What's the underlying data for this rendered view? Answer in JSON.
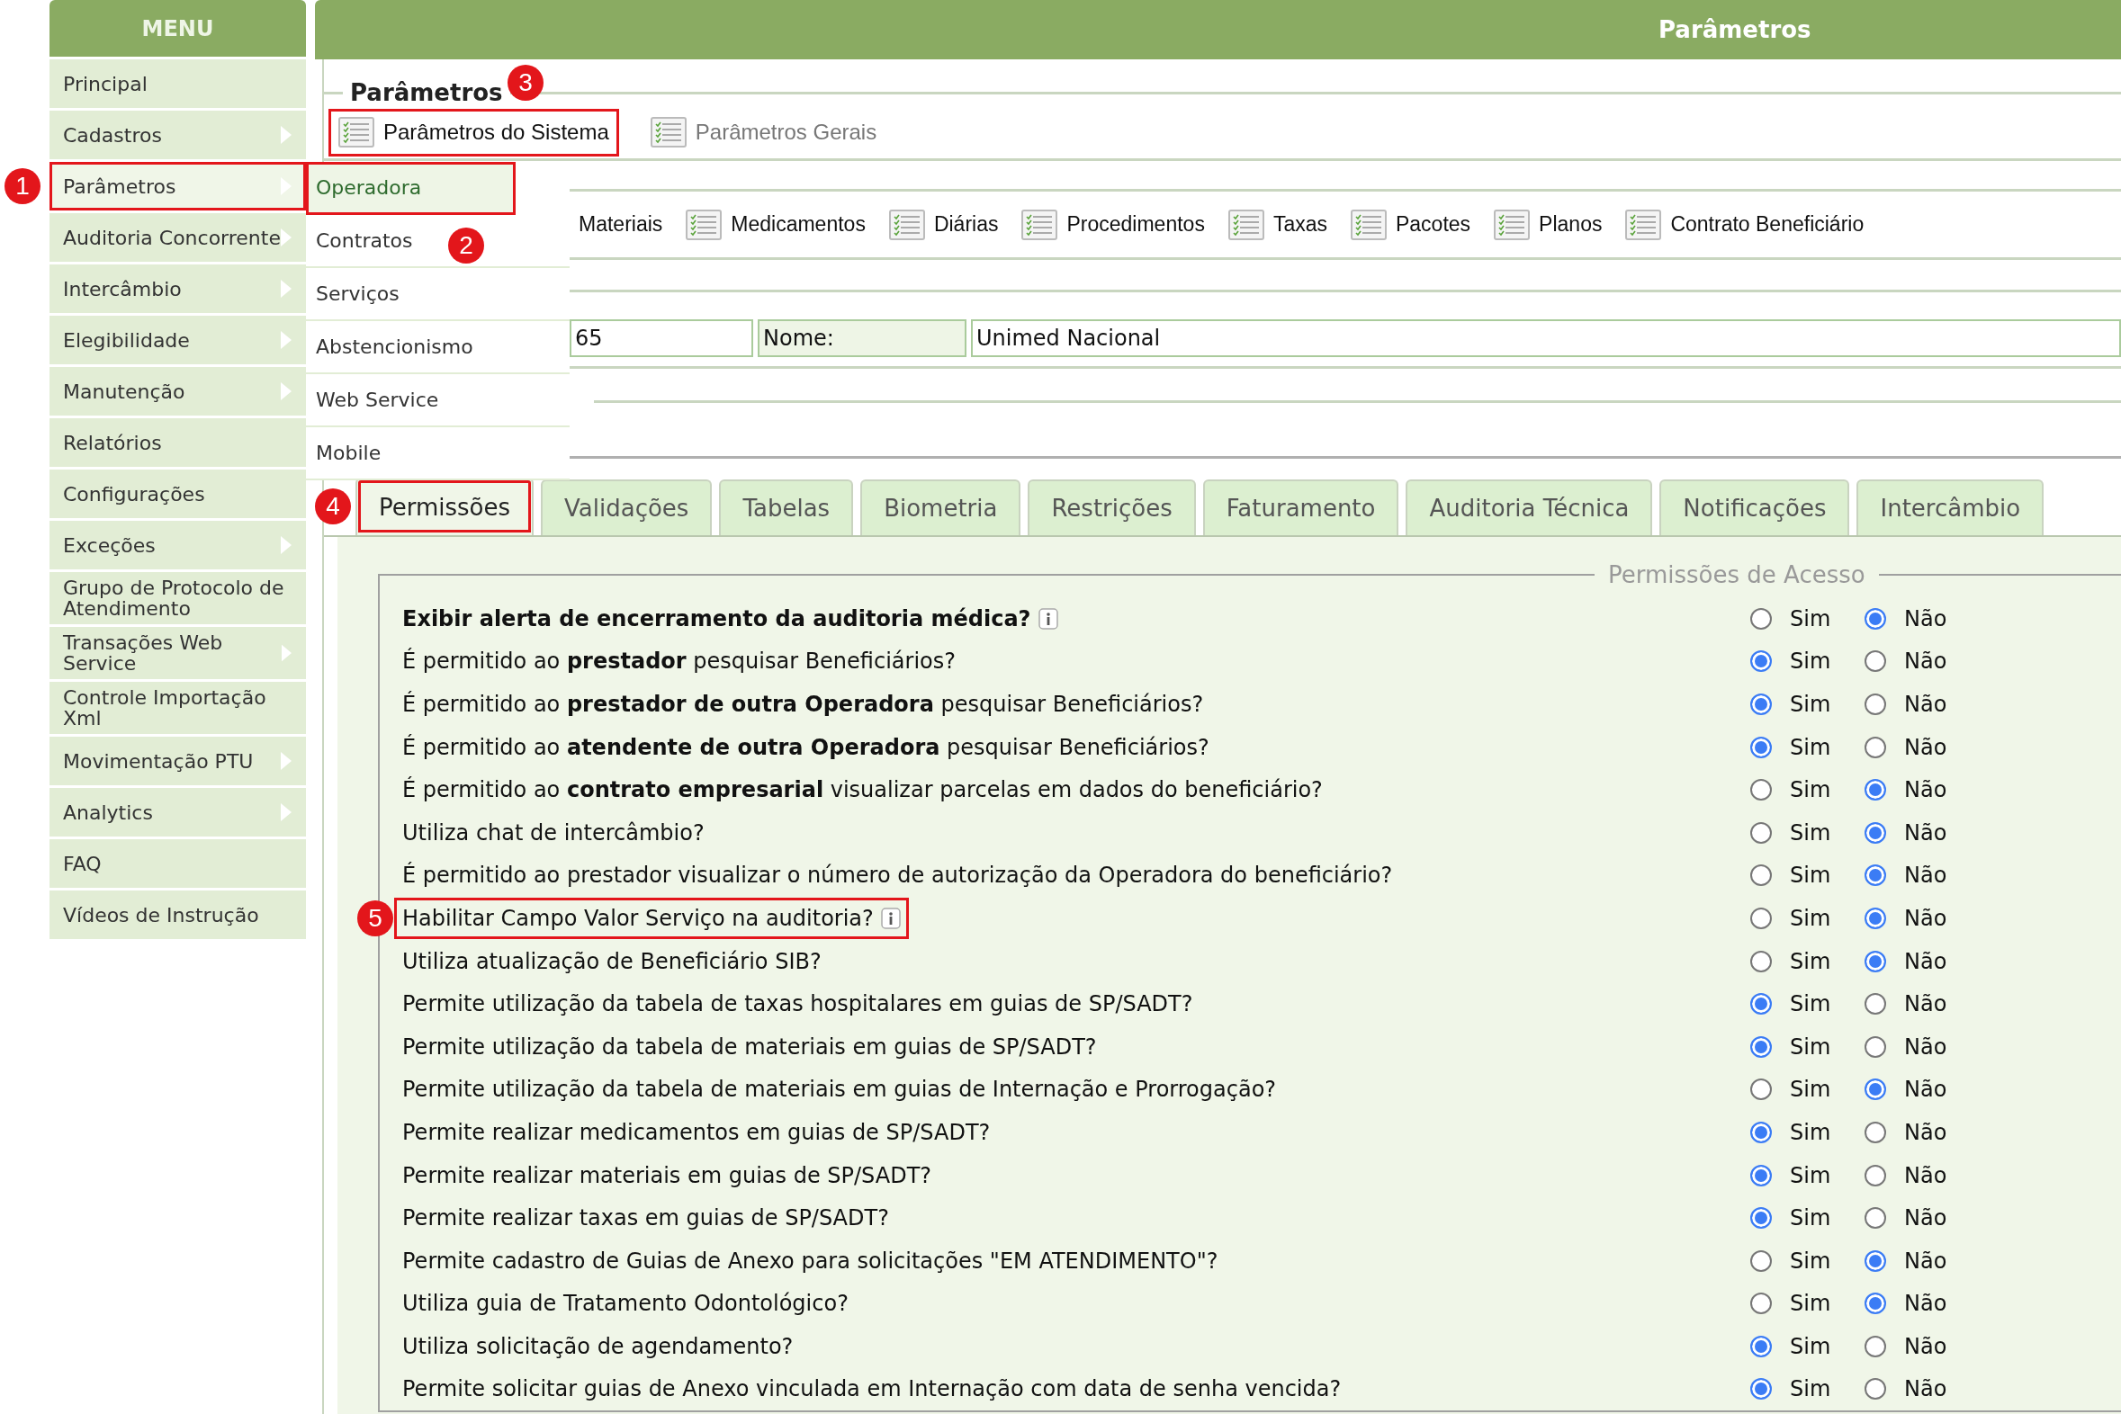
{
  "menu": {
    "title": "MENU",
    "items": [
      {
        "label": "Principal",
        "has_submenu": false,
        "selected": false
      },
      {
        "label": "Cadastros",
        "has_submenu": true,
        "selected": false
      },
      {
        "label": "Parâmetros",
        "has_submenu": true,
        "selected": true,
        "callout": {
          "number": "1",
          "boxed": true
        }
      },
      {
        "label": "Auditoria Concorrente",
        "has_submenu": true,
        "selected": false
      },
      {
        "label": "Intercâmbio",
        "has_submenu": true,
        "selected": false
      },
      {
        "label": "Elegibilidade",
        "has_submenu": true,
        "selected": false
      },
      {
        "label": "Manutenção",
        "has_submenu": true,
        "selected": false
      },
      {
        "label": "Relatórios",
        "has_submenu": false,
        "selected": false
      },
      {
        "label": "Configurações",
        "has_submenu": false,
        "selected": false
      },
      {
        "label": "Exceções",
        "has_submenu": true,
        "selected": false
      },
      {
        "label": "Grupo de Protocolo de Atendimento",
        "has_submenu": false,
        "selected": false
      },
      {
        "label": "Transações Web Service",
        "has_submenu": true,
        "selected": false
      },
      {
        "label": "Controle Importação Xml",
        "has_submenu": false,
        "selected": false
      },
      {
        "label": "Movimentação PTU",
        "has_submenu": true,
        "selected": false
      },
      {
        "label": "Analytics",
        "has_submenu": true,
        "selected": false
      },
      {
        "label": "FAQ",
        "has_submenu": false,
        "selected": false
      },
      {
        "label": "Vídeos de Instrução",
        "has_submenu": false,
        "selected": false
      }
    ]
  },
  "submenu": {
    "items": [
      {
        "label": "Operadora",
        "selected": true,
        "callout": {
          "boxed": true
        }
      },
      {
        "label": "Contratos",
        "selected": false,
        "callout": {
          "number": "2",
          "boxed": false
        }
      },
      {
        "label": "Serviços",
        "selected": false
      },
      {
        "label": "Abstencionismo",
        "selected": false
      },
      {
        "label": "Web Service",
        "selected": false
      },
      {
        "label": "Mobile",
        "selected": false
      }
    ]
  },
  "header": {
    "title": "Parâmetros"
  },
  "section": {
    "title": "Parâmetros",
    "tabs": [
      {
        "label": "Parâmetros do Sistema",
        "selected": true,
        "callout": {
          "number": "3",
          "boxed": true
        }
      },
      {
        "label": "Parâmetros Gerais",
        "selected": false
      }
    ]
  },
  "shortcuts": [
    {
      "label": "Materiais",
      "icon": false
    },
    {
      "label": "Medicamentos",
      "icon": true
    },
    {
      "label": "Diárias",
      "icon": true
    },
    {
      "label": "Procedimentos",
      "icon": true
    },
    {
      "label": "Taxas",
      "icon": true
    },
    {
      "label": "Pacotes",
      "icon": true
    },
    {
      "label": "Planos",
      "icon": true
    },
    {
      "label": "Contrato Beneficiário",
      "icon": true
    }
  ],
  "operator": {
    "code": "65",
    "name_label": "Nome:",
    "name": "Unimed Nacional"
  },
  "tabs": [
    {
      "label": "Permissões",
      "selected": true,
      "callout": {
        "number": "4",
        "boxed": true
      }
    },
    {
      "label": "Validações",
      "selected": false
    },
    {
      "label": "Tabelas",
      "selected": false
    },
    {
      "label": "Biometria",
      "selected": false
    },
    {
      "label": "Restrições",
      "selected": false
    },
    {
      "label": "Faturamento",
      "selected": false
    },
    {
      "label": "Auditoria Técnica",
      "selected": false
    },
    {
      "label": "Notificações",
      "selected": false
    },
    {
      "label": "Intercâmbio",
      "selected": false
    }
  ],
  "permissions": {
    "legend": "Permissões de Acesso",
    "rows": [
      {
        "question": "Exibir alerta de encerramento da auditoria médica?",
        "bold": true,
        "info": true,
        "options": [
          {
            "label": "Sim",
            "selected": false
          },
          {
            "label": "Não",
            "selected": true
          }
        ]
      },
      {
        "question": "É permitido ao **prestador** pesquisar Beneficiários?",
        "options": [
          {
            "label": "Sim",
            "selected": true
          },
          {
            "label": "Não",
            "selected": false
          }
        ]
      },
      {
        "question": "É permitido ao **prestador de outra Operadora** pesquisar Beneficiários?",
        "options": [
          {
            "label": "Sim",
            "selected": true
          },
          {
            "label": "Não",
            "selected": false
          }
        ]
      },
      {
        "question": "É permitido ao **atendente de outra Operadora** pesquisar Beneficiários?",
        "options": [
          {
            "label": "Sim",
            "selected": true
          },
          {
            "label": "Não",
            "selected": false
          }
        ]
      },
      {
        "question": "É permitido ao **contrato empresarial** visualizar parcelas em dados do beneficiário?",
        "options": [
          {
            "label": "Sim",
            "selected": false
          },
          {
            "label": "Não",
            "selected": true
          }
        ]
      },
      {
        "question": "Utiliza chat de intercâmbio?",
        "options": [
          {
            "label": "Sim",
            "selected": false
          },
          {
            "label": "Não",
            "selected": true
          }
        ]
      },
      {
        "question": "É permitido ao prestador visualizar o número de autorização da Operadora do beneficiário?",
        "options": [
          {
            "label": "Sim",
            "selected": false
          },
          {
            "label": "Não",
            "selected": true
          }
        ]
      },
      {
        "question": "Habilitar Campo Valor Serviço na auditoria?",
        "info": true,
        "callout": {
          "number": "5",
          "boxed": true
        },
        "options": [
          {
            "label": "Sim",
            "selected": false
          },
          {
            "label": "Não",
            "selected": true
          }
        ]
      },
      {
        "question": "Utiliza atualização de Beneficiário SIB?",
        "options": [
          {
            "label": "Sim",
            "selected": false
          },
          {
            "label": "Não",
            "selected": true
          }
        ]
      },
      {
        "question": "Permite utilização da tabela de taxas hospitalares em guias de SP/SADT?",
        "options": [
          {
            "label": "Sim",
            "selected": true
          },
          {
            "label": "Não",
            "selected": false
          }
        ]
      },
      {
        "question": "Permite utilização da tabela de materiais em guias de SP/SADT?",
        "options": [
          {
            "label": "Sim",
            "selected": true
          },
          {
            "label": "Não",
            "selected": false
          }
        ]
      },
      {
        "question": "Permite utilização da tabela de materiais em guias de Internação e Prorrogação?",
        "options": [
          {
            "label": "Sim",
            "selected": false
          },
          {
            "label": "Não",
            "selected": true
          }
        ]
      },
      {
        "question": "Permite realizar medicamentos em guias de SP/SADT?",
        "options": [
          {
            "label": "Sim",
            "selected": true
          },
          {
            "label": "Não",
            "selected": false
          }
        ]
      },
      {
        "question": "Permite realizar materiais em guias de SP/SADT?",
        "options": [
          {
            "label": "Sim",
            "selected": true
          },
          {
            "label": "Não",
            "selected": false
          }
        ]
      },
      {
        "question": "Permite realizar taxas em guias de SP/SADT?",
        "options": [
          {
            "label": "Sim",
            "selected": true
          },
          {
            "label": "Não",
            "selected": false
          }
        ]
      },
      {
        "question": "Permite cadastro de Guias de Anexo para solicitações \"EM ATENDIMENTO\"?",
        "options": [
          {
            "label": "Sim",
            "selected": false
          },
          {
            "label": "Não",
            "selected": true
          }
        ]
      },
      {
        "question": "Utiliza guia de Tratamento Odontológico?",
        "options": [
          {
            "label": "Sim",
            "selected": false
          },
          {
            "label": "Não",
            "selected": true
          }
        ]
      },
      {
        "question": "Utiliza solicitação de agendamento?",
        "options": [
          {
            "label": "Sim",
            "selected": true
          },
          {
            "label": "Não",
            "selected": false
          }
        ]
      },
      {
        "question": "Permite solicitar guias de Anexo vinculada em Internação com data de senha vencida?",
        "options": [
          {
            "label": "Sim",
            "selected": true
          },
          {
            "label": "Não",
            "selected": false
          }
        ]
      }
    ]
  }
}
